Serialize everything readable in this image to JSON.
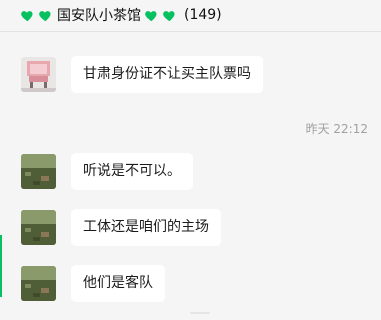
{
  "header": {
    "title": "国安队小茶馆",
    "member_count": "(149)",
    "heart_color": "#07c160",
    "left_icons": [
      "green-heart-icon",
      "green-heart-icon"
    ],
    "right_icons": [
      "green-heart-icon",
      "green-heart-icon"
    ]
  },
  "messages": [
    {
      "sender_avatar": "avatar-pink-chair",
      "text": "甘肃身份证不让买主队票吗"
    },
    {
      "sender_avatar": "avatar-field",
      "text": "听说是不可以。"
    },
    {
      "sender_avatar": "avatar-field",
      "text": "工体还是咱们的主场"
    },
    {
      "sender_avatar": "avatar-field",
      "text": "他们是客队"
    }
  ],
  "timestamp": "昨天 22:12"
}
